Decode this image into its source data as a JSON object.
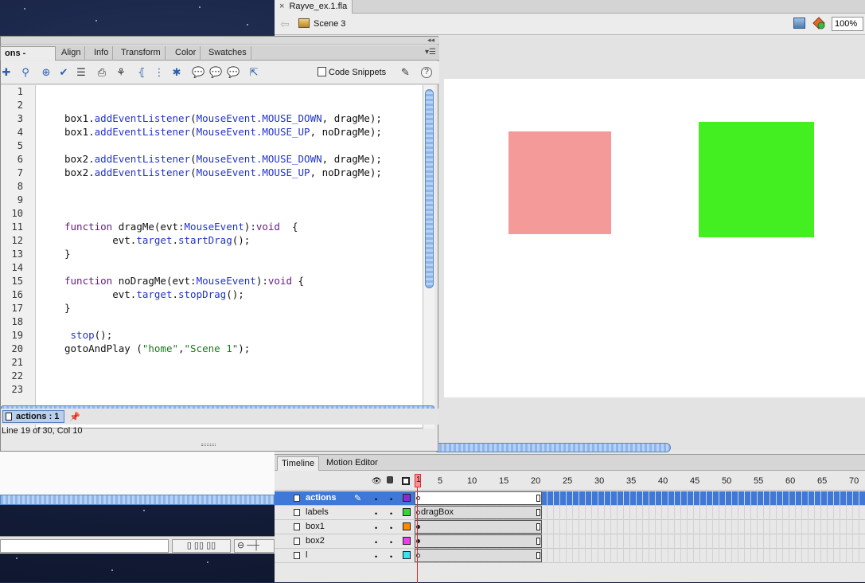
{
  "document": {
    "tab_close": "×",
    "tab_title": "Rayve_ex.1.fla",
    "scene_label": "Scene 3",
    "zoom": "100%",
    "stage": {
      "pink_color": "#f49a98",
      "green_color": "#43ef21",
      "background": "#ffffff"
    }
  },
  "actions_panel": {
    "tabs": [
      "ons - Frame",
      "Align",
      "Info",
      "Transform",
      "Color",
      "Swatches"
    ],
    "active_tab": "ons - Frame",
    "code_snippets_label": "Code Snippets",
    "help_label": "?",
    "lines": [
      {
        "n": "1",
        "code": ""
      },
      {
        "n": "2",
        "code": ""
      },
      {
        "n": "3",
        "code": "box1.addEventListener(MouseEvent.MOUSE_DOWN, dragMe);"
      },
      {
        "n": "4",
        "code": "box1.addEventListener(MouseEvent.MOUSE_UP, noDragMe);"
      },
      {
        "n": "5",
        "code": ""
      },
      {
        "n": "6",
        "code": "box2.addEventListener(MouseEvent.MOUSE_DOWN, dragMe);"
      },
      {
        "n": "7",
        "code": "box2.addEventListener(MouseEvent.MOUSE_UP, noDragMe);"
      },
      {
        "n": "8",
        "code": ""
      },
      {
        "n": "9",
        "code": ""
      },
      {
        "n": "10",
        "code": ""
      },
      {
        "n": "11",
        "code": "function dragMe(evt:MouseEvent):void  {"
      },
      {
        "n": "12",
        "code": "        evt.target.startDrag();"
      },
      {
        "n": "13",
        "code": "}"
      },
      {
        "n": "14",
        "code": ""
      },
      {
        "n": "15",
        "code": "function noDragMe(evt:MouseEvent):void {"
      },
      {
        "n": "16",
        "code": "        evt.target.stopDrag();"
      },
      {
        "n": "17",
        "code": "}"
      },
      {
        "n": "18",
        "code": ""
      },
      {
        "n": "19",
        "code": " stop();"
      },
      {
        "n": "20",
        "code": "gotoAndPlay (\"home\",\"Scene 1\");"
      },
      {
        "n": "21",
        "code": ""
      },
      {
        "n": "22",
        "code": ""
      },
      {
        "n": "23",
        "code": ""
      }
    ],
    "script_tab": "actions : 1",
    "status": "Line 19 of 30, Col 10"
  },
  "timeline": {
    "tabs": [
      "Timeline",
      "Motion Editor"
    ],
    "frame_numbers": [
      "1",
      "5",
      "10",
      "15",
      "20",
      "25",
      "30",
      "35",
      "40",
      "45",
      "50",
      "55",
      "60",
      "65",
      "70"
    ],
    "playhead_frame": "1",
    "layers": [
      {
        "name": "actions",
        "color": "#8a2bd6",
        "selected": true,
        "keyframe": "empty",
        "label": ""
      },
      {
        "name": "labels",
        "color": "#37d637",
        "selected": false,
        "keyframe": "empty",
        "label": "dragBox"
      },
      {
        "name": "box1",
        "color": "#ff8a00",
        "selected": false,
        "keyframe": "filled",
        "label": ""
      },
      {
        "name": "box2",
        "color": "#f03cf0",
        "selected": false,
        "keyframe": "filled",
        "label": ""
      },
      {
        "name": "l",
        "color": "#35e6ef",
        "selected": false,
        "keyframe": "empty",
        "label": ""
      }
    ]
  },
  "left_panel": {
    "zoom_out_label": "⊖"
  }
}
